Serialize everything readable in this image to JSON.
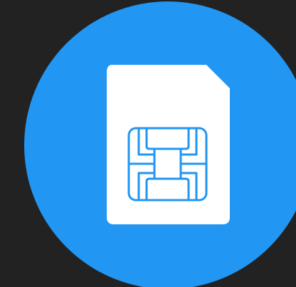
{
  "icon": {
    "name": "sim-card-icon",
    "colors": {
      "background": "#222222",
      "circle": "#2196F3",
      "card": "#FFFFFF",
      "chip": "#2196F3"
    }
  }
}
